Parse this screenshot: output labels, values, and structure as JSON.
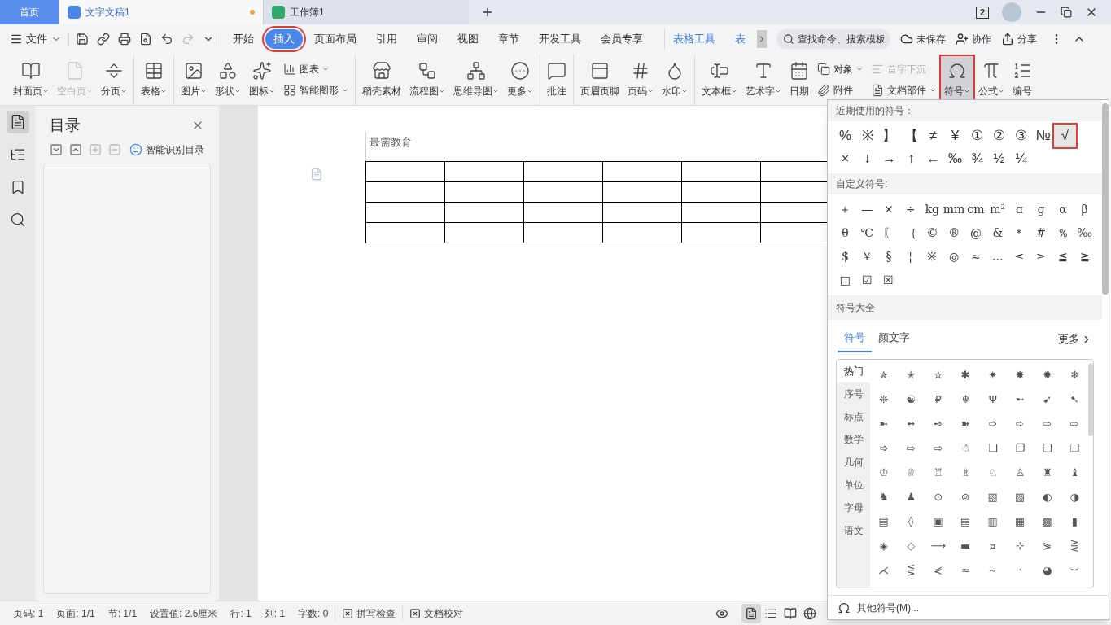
{
  "tabbar": {
    "home": "首页",
    "tabs": [
      {
        "label": "文字文稿1",
        "kind": "doc",
        "selected": true,
        "modified": true
      },
      {
        "label": "工作簿1",
        "kind": "sheet",
        "selected": false,
        "modified": false
      }
    ],
    "badge": "2"
  },
  "menu": {
    "file": "文件",
    "tabs": [
      {
        "label": "开始",
        "selected": false,
        "marked": false,
        "context": false
      },
      {
        "label": "插入",
        "selected": true,
        "marked": true,
        "context": false
      },
      {
        "label": "页面布局",
        "selected": false,
        "marked": false,
        "context": false
      },
      {
        "label": "引用",
        "selected": false,
        "marked": false,
        "context": false
      },
      {
        "label": "审阅",
        "selected": false,
        "marked": false,
        "context": false
      },
      {
        "label": "视图",
        "selected": false,
        "marked": false,
        "context": false
      },
      {
        "label": "章节",
        "selected": false,
        "marked": false,
        "context": false
      },
      {
        "label": "开发工具",
        "selected": false,
        "marked": false,
        "context": false
      },
      {
        "label": "会员专享",
        "selected": false,
        "marked": false,
        "context": false
      },
      {
        "label": "表格工具",
        "selected": false,
        "marked": false,
        "context": true
      },
      {
        "label": "表",
        "selected": false,
        "marked": false,
        "context": true
      }
    ],
    "search": {
      "placeholder": "查找命令、搜索模板"
    },
    "actions": [
      "未保存",
      "协作",
      "分享"
    ]
  },
  "ribbon": [
    [
      {
        "kind": "large",
        "label": "封面页",
        "dropdown": true,
        "disabled": false,
        "marked": false
      },
      {
        "kind": "large",
        "label": "空白页",
        "dropdown": true,
        "disabled": true,
        "marked": false
      },
      {
        "kind": "large",
        "label": "分页",
        "dropdown": true,
        "disabled": false,
        "marked": false
      }
    ],
    [
      {
        "kind": "large",
        "label": "表格",
        "dropdown": true,
        "disabled": false,
        "marked": false
      }
    ],
    [
      {
        "kind": "large",
        "label": "图片",
        "dropdown": true,
        "disabled": false,
        "marked": false
      },
      {
        "kind": "large",
        "label": "形状",
        "dropdown": true,
        "disabled": false,
        "marked": false
      },
      {
        "kind": "large",
        "label": "图标",
        "dropdown": true,
        "disabled": false,
        "marked": false
      },
      {
        "kind": "stack",
        "items": [
          {
            "label": "图表",
            "dropdown": true,
            "disabled": false
          },
          {
            "label": "智能图形",
            "dropdown": true,
            "disabled": false
          }
        ]
      }
    ],
    [
      {
        "kind": "large",
        "label": "稻壳素材",
        "dropdown": false,
        "disabled": false,
        "marked": false
      },
      {
        "kind": "large",
        "label": "流程图",
        "dropdown": true,
        "disabled": false,
        "marked": false
      },
      {
        "kind": "large",
        "label": "思维导图",
        "dropdown": true,
        "disabled": false,
        "marked": false
      },
      {
        "kind": "large",
        "label": "更多",
        "dropdown": true,
        "disabled": false,
        "marked": false
      }
    ],
    [
      {
        "kind": "large",
        "label": "批注",
        "dropdown": false,
        "disabled": false,
        "marked": false
      }
    ],
    [
      {
        "kind": "large",
        "label": "页眉页脚",
        "dropdown": false,
        "disabled": false,
        "marked": false
      },
      {
        "kind": "large",
        "label": "页码",
        "dropdown": true,
        "disabled": false,
        "marked": false
      },
      {
        "kind": "large",
        "label": "水印",
        "dropdown": true,
        "disabled": false,
        "marked": false
      }
    ],
    [
      {
        "kind": "large",
        "label": "文本框",
        "dropdown": true,
        "disabled": false,
        "marked": false
      },
      {
        "kind": "large",
        "label": "艺术字",
        "dropdown": true,
        "disabled": false,
        "marked": false
      },
      {
        "kind": "large",
        "label": "日期",
        "dropdown": false,
        "disabled": false,
        "marked": false
      },
      {
        "kind": "stack",
        "items": [
          {
            "label": "对象",
            "dropdown": true,
            "disabled": false
          },
          {
            "label": "附件",
            "dropdown": false,
            "disabled": false
          }
        ]
      },
      {
        "kind": "stack",
        "items": [
          {
            "label": "首字下沉",
            "dropdown": false,
            "disabled": true
          },
          {
            "label": "文档部件",
            "dropdown": true,
            "disabled": false
          }
        ]
      },
      {
        "kind": "large",
        "label": "符号",
        "dropdown": true,
        "disabled": false,
        "marked": true,
        "pressed": true
      },
      {
        "kind": "large",
        "label": "公式",
        "dropdown": true,
        "disabled": false,
        "marked": false
      },
      {
        "kind": "large",
        "label": "编号",
        "dropdown": false,
        "disabled": false,
        "marked": false
      }
    ]
  ],
  "outline": {
    "title": "目录",
    "smart": "智能识别目录"
  },
  "document": {
    "header": "最需教育"
  },
  "status_bar": {
    "items": [
      "页码: 1",
      "页面: 1/1",
      "节: 1/1",
      "设置值: 2.5厘米",
      "行: 1",
      "列: 1",
      "字数: 0"
    ],
    "checks": [
      "拼写检查",
      "文档校对"
    ],
    "views": [
      {
        "selected": true
      },
      {
        "selected": false
      },
      {
        "selected": false
      },
      {
        "selected": false
      }
    ]
  },
  "symbols": {
    "recent_title": "近期使用的符号：",
    "recent": [
      [
        {
          "char": "%",
          "selected": false
        },
        {
          "char": "※",
          "selected": false
        },
        {
          "char": "】",
          "selected": false
        },
        {
          "char": "【",
          "selected": false
        },
        {
          "char": "≠",
          "selected": false
        },
        {
          "char": "¥",
          "selected": false
        },
        {
          "char": "①",
          "selected": false
        },
        {
          "char": "②",
          "selected": false
        },
        {
          "char": "③",
          "selected": false
        },
        {
          "char": "№",
          "selected": false
        },
        {
          "char": "√",
          "selected": true
        }
      ],
      [
        {
          "char": "×",
          "selected": false
        },
        {
          "char": "↓",
          "selected": false
        },
        {
          "char": "→",
          "selected": false
        },
        {
          "char": "↑",
          "selected": false
        },
        {
          "char": "←",
          "selected": false
        },
        {
          "char": "‰",
          "selected": false
        },
        {
          "char": "¾",
          "selected": false
        },
        {
          "char": "½",
          "selected": false
        },
        {
          "char": "¼",
          "selected": false
        }
      ]
    ],
    "custom_title": "自定义符号:",
    "custom": [
      "＋",
      "—",
      "×",
      "÷",
      "kg",
      "mm",
      "cm",
      "m²",
      "ɑ",
      "ɡ",
      "α",
      "β",
      "θ",
      "℃",
      "〖",
      "｛",
      "©",
      "®",
      "@",
      "&",
      "＊",
      "#",
      "％",
      "‰",
      "$",
      "￥",
      "§",
      "¦",
      "※",
      "◎",
      "≈",
      "…",
      "≤",
      "≥",
      "≦",
      "≧",
      "□",
      "☑",
      "☒"
    ],
    "all_title": "符号大全",
    "tabs": [
      {
        "label": "符号",
        "selected": true
      },
      {
        "label": "颜文字",
        "selected": false
      }
    ],
    "more": "更多",
    "categories": [
      {
        "label": "热门",
        "selected": true
      },
      {
        "label": "序号",
        "selected": false
      },
      {
        "label": "标点",
        "selected": false
      },
      {
        "label": "数学",
        "selected": false
      },
      {
        "label": "几何",
        "selected": false
      },
      {
        "label": "单位",
        "selected": false
      },
      {
        "label": "字母",
        "selected": false
      },
      {
        "label": "语文",
        "selected": false
      }
    ],
    "grid": [
      "✯",
      "✭",
      "✮",
      "✱",
      "✷",
      "✸",
      "✹",
      "❄",
      "❊",
      "☯",
      "₽",
      "☬",
      "Ψ",
      "➸",
      "➹",
      "➷",
      "➼",
      "➻",
      "➺",
      "➽",
      "➩",
      "➪",
      "⇨",
      "⇨",
      "➩",
      "⇨",
      "⇨",
      "☃",
      "❏",
      "❐",
      "❑",
      "❒",
      "♔",
      "♕",
      "♖",
      "♗",
      "♘",
      "♙",
      "♜",
      "♝",
      "♞",
      "♟",
      "⊙",
      "⊚",
      "▧",
      "▨",
      "◐",
      "◑",
      "▤",
      "◊",
      "▣",
      "▤",
      "▥",
      "▦",
      "▩",
      "▮",
      "◈",
      "◇",
      "⟶",
      "▬",
      "¤",
      "⊹",
      "⋟",
      "⋛",
      "⋌",
      "⋚",
      "⋞",
      "≈",
      "～",
      "·",
      "◕",
      "︶"
    ],
    "footer": "其他符号(M)..."
  }
}
